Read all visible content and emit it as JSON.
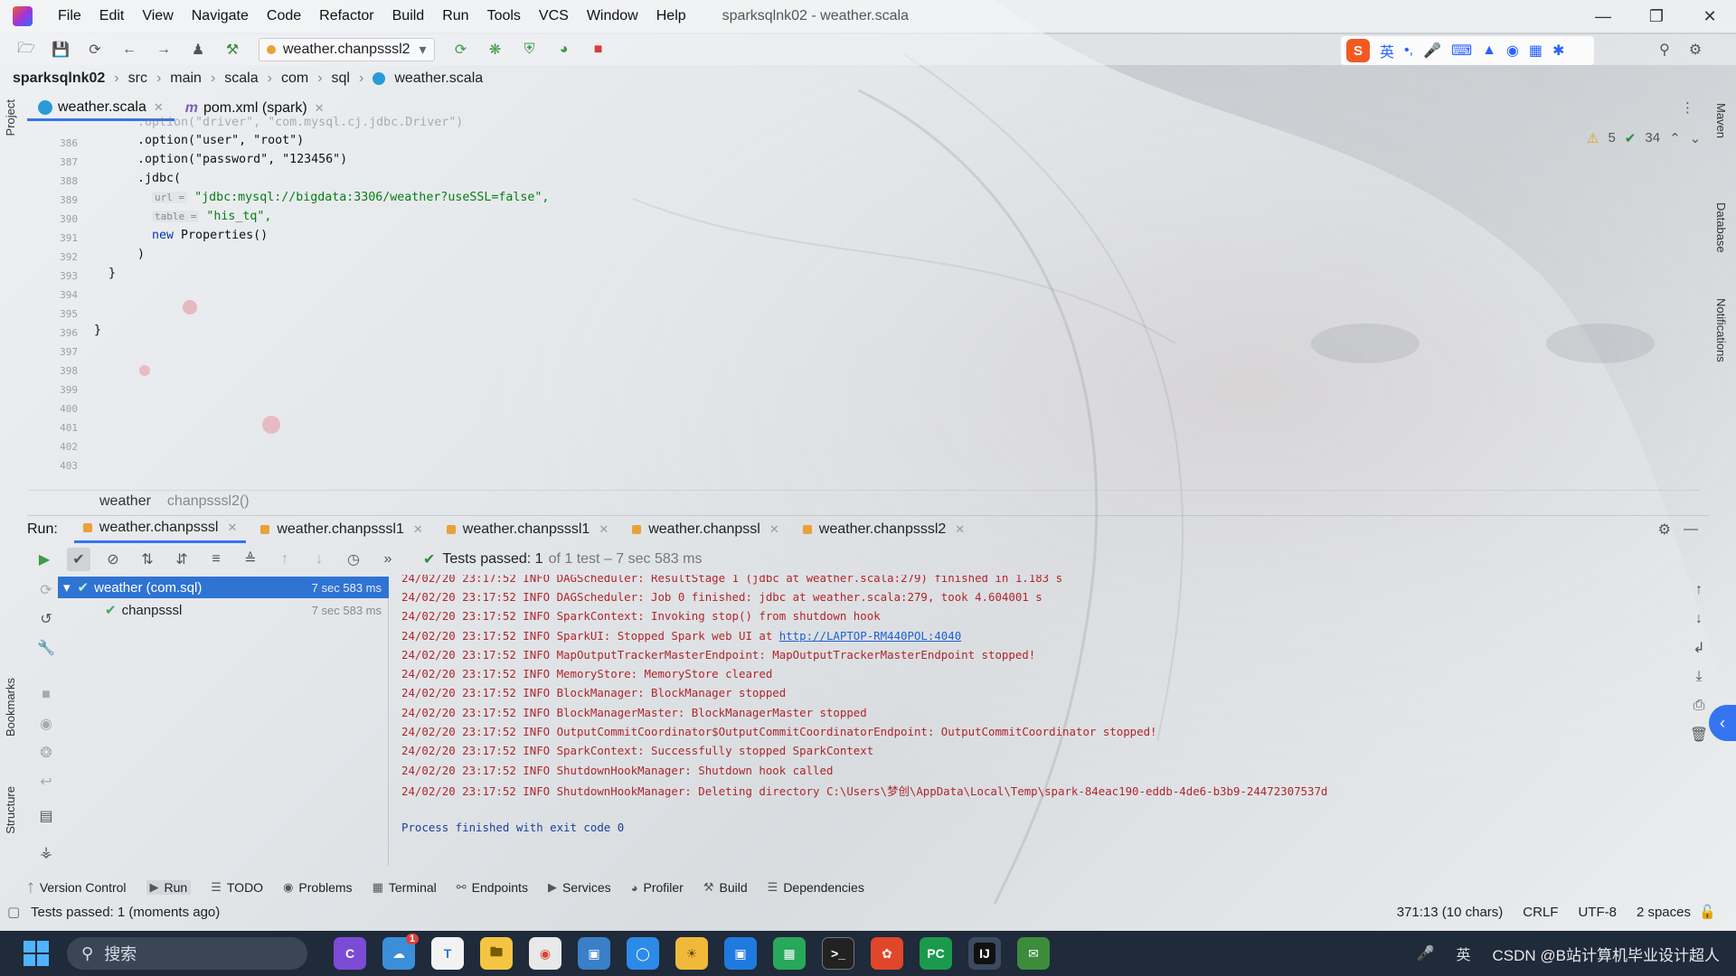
{
  "window": {
    "menu": [
      "File",
      "Edit",
      "View",
      "Navigate",
      "Code",
      "Refactor",
      "Build",
      "Run",
      "Tools",
      "VCS",
      "Window",
      "Help"
    ],
    "title": "sparksqlnk02 - weather.scala"
  },
  "toolbar": {
    "run_config": "weather.chanpsssl2"
  },
  "ime": {
    "mode": "英"
  },
  "breadcrumb": [
    "sparksqlnk02",
    "src",
    "main",
    "scala",
    "com",
    "sql",
    "weather.scala"
  ],
  "side_labels": {
    "project": "Project",
    "bookmarks": "Bookmarks",
    "structure": "Structure",
    "maven": "Maven",
    "database": "Database",
    "notifications": "Notifications"
  },
  "editor_tabs": [
    {
      "label": "weather.scala",
      "active": true
    },
    {
      "label": "pom.xml (spark)",
      "active": false
    }
  ],
  "inspections": {
    "warnings": "5",
    "ok": "34"
  },
  "line_numbers": [
    "386",
    "387",
    "388",
    "389",
    "390",
    "391",
    "392",
    "393",
    "394",
    "395",
    "396",
    "397",
    "398",
    "399",
    "400",
    "401",
    "402",
    "403"
  ],
  "code": {
    "l386_top": ".option(\"driver\", \"com.mysql.cj.jdbc.Driver\")",
    "l387_a": ".option(\"user\", \"root\")",
    "l388_a": ".option(\"password\", \"123456\")",
    "l389": ".jdbc(",
    "l390_hint": "url =",
    "l390_str": "\"jdbc:mysql://bigdata:3306/weather?useSSL=false\",",
    "l391_hint": "table =",
    "l391_str": "\"his_tq\",",
    "l392_kw": "new",
    "l392_rest": "Properties()",
    "l393": ")",
    "l394": "}",
    "l397": "}"
  },
  "editor_crumb": {
    "file": "weather",
    "method": "chanpsssl2()"
  },
  "run_panel": {
    "label": "Run:",
    "tabs": [
      {
        "label": "weather.chanpsssl",
        "active": true
      },
      {
        "label": "weather.chanpsssl1",
        "active": false
      },
      {
        "label": "weather.chanpsssl1",
        "active": false
      },
      {
        "label": "weather.chanpssl",
        "active": false
      },
      {
        "label": "weather.chanpsssl2",
        "active": false
      }
    ],
    "summary_main": "Tests passed: 1",
    "summary_sub": "of 1 test – 7 sec 583 ms",
    "tree": [
      {
        "label": "weather (com.sql)",
        "time": "7 sec 583 ms",
        "selected": true
      },
      {
        "label": "chanpsssl",
        "time": "7 sec 583 ms",
        "selected": false
      }
    ],
    "console": [
      "24/02/20 23:17:52 INFO DAGScheduler: ResultStage 1 (jdbc at weather.scala:279) finished in 1.183 s",
      "24/02/20 23:17:52 INFO DAGScheduler: Job 0 finished: jdbc at weather.scala:279, took 4.604001 s",
      "24/02/20 23:17:52 INFO SparkContext: Invoking stop() from shutdown hook",
      "24/02/20 23:17:52 INFO SparkUI: Stopped Spark web UI at ",
      "24/02/20 23:17:52 INFO MapOutputTrackerMasterEndpoint: MapOutputTrackerMasterEndpoint stopped!",
      "24/02/20 23:17:52 INFO MemoryStore: MemoryStore cleared",
      "24/02/20 23:17:52 INFO BlockManager: BlockManager stopped",
      "24/02/20 23:17:52 INFO BlockManagerMaster: BlockManagerMaster stopped",
      "24/02/20 23:17:52 INFO OutputCommitCoordinator$OutputCommitCoordinatorEndpoint: OutputCommitCoordinator stopped!",
      "24/02/20 23:17:52 INFO SparkContext: Successfully stopped SparkContext",
      "24/02/20 23:17:52 INFO ShutdownHookManager: Shutdown hook called",
      "24/02/20 23:17:52 INFO ShutdownHookManager: Deleting directory C:\\Users\\梦创\\AppData\\Local\\Temp\\spark-84eac190-eddb-4de6-b3b9-24472307537d"
    ],
    "console_link": "http://LAPTOP-RM440POL:4040",
    "exit_line": "Process finished with exit code 0"
  },
  "bottom_tools": [
    "Version Control",
    "Run",
    "TODO",
    "Problems",
    "Terminal",
    "Endpoints",
    "Services",
    "Profiler",
    "Build",
    "Dependencies"
  ],
  "status": {
    "message": "Tests passed: 1 (moments ago)",
    "position": "371:13 (10 chars)",
    "line_sep": "CRLF",
    "encoding": "UTF-8",
    "indent": "2 spaces"
  },
  "taskbar": {
    "search_placeholder": "搜索",
    "notification_count": "1",
    "tray_lang": "英",
    "watermark": "CSDN @B站计算机毕业设计超人"
  },
  "colors": {
    "accent": "#3574f0",
    "error_text": "#b0262c",
    "ok": "#46a35a",
    "string": "#067d17",
    "keyword": "#0033b3"
  }
}
